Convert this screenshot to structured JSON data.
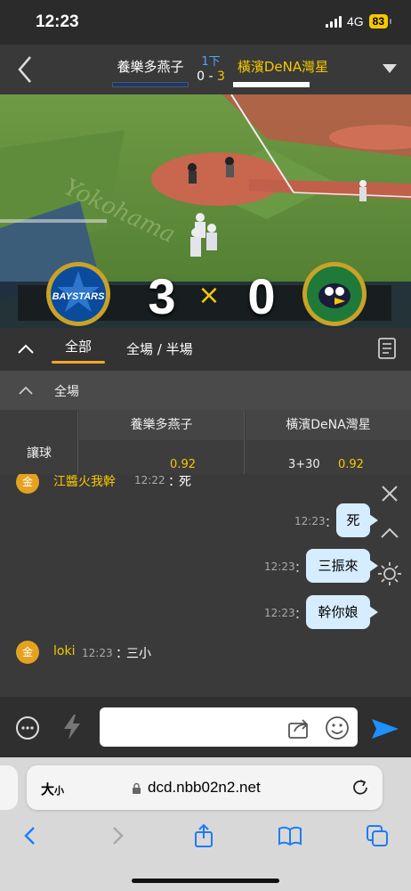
{
  "status_bar": {
    "time": "12:23",
    "network": "4G",
    "battery": "83"
  },
  "header": {
    "home_team": "養樂多燕子",
    "inning": "1下",
    "score_home": "0",
    "score_separator": "-",
    "score_away": "3",
    "away_team": "橫濱DeNA灣星"
  },
  "video": {
    "scoreboard_left": "3",
    "scoreboard_sep": "×",
    "scoreboard_right": "0"
  },
  "tabs": {
    "all": "全部",
    "full_half": "全場 / 半場"
  },
  "odds": {
    "section_title": "全場",
    "row_label": "讓球",
    "col1_team": "養樂多燕子",
    "col2_team": "橫濱DeNA灣星",
    "col1_odds": "0.92",
    "col2_line": "3+30",
    "col2_odds": "0.92"
  },
  "chat": {
    "messages": [
      {
        "avatar": "金",
        "name": "江醬火我幹",
        "time": "12:22",
        "sep": "：",
        "text": "死"
      },
      {
        "time": "12:23",
        "sep": "：",
        "text": "死"
      },
      {
        "time": "12:23",
        "sep": "：",
        "text": "三振來"
      },
      {
        "time": "12:23",
        "sep": "：",
        "text": "幹你娘"
      },
      {
        "avatar": "金",
        "name": "loki",
        "time": "12:23",
        "sep": "：",
        "text": "三小"
      }
    ]
  },
  "input": {
    "placeholder": ""
  },
  "browser": {
    "text_size": "大",
    "text_size_small": "小",
    "url": "dcd.nbb02n2.net"
  },
  "colors": {
    "accent": "#f5c800",
    "tab_underline": "#f5a623",
    "send": "#1e90ff",
    "bubble": "#d6ecff"
  }
}
